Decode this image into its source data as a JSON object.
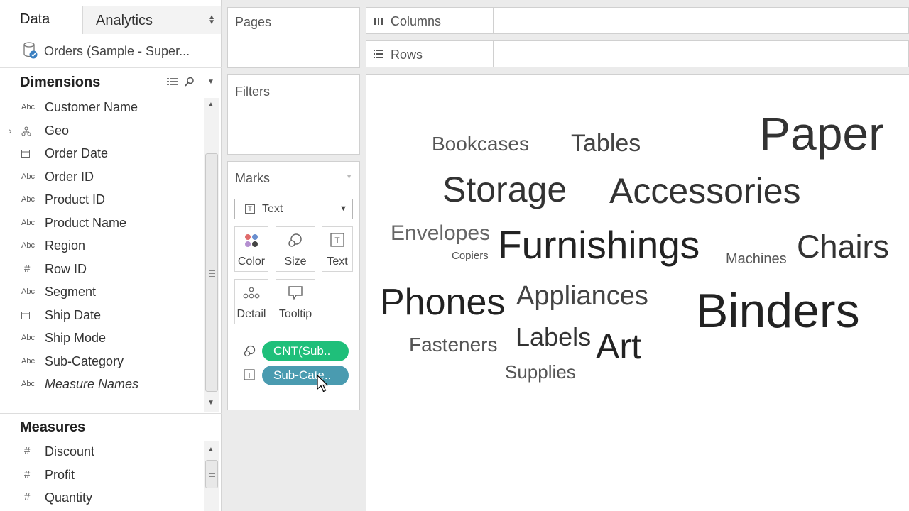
{
  "tabs": {
    "data": "Data",
    "analytics": "Analytics"
  },
  "datasource": {
    "label": "Orders (Sample - Super...",
    "icon": "database-icon"
  },
  "dimensions": {
    "title": "Dimensions",
    "fields": [
      {
        "type": "Abc",
        "name": "Customer Name"
      },
      {
        "type": "geo-icon",
        "name": "Geo"
      },
      {
        "type": "calendar-icon",
        "name": "Order Date"
      },
      {
        "type": "Abc",
        "name": "Order ID"
      },
      {
        "type": "Abc",
        "name": "Product ID"
      },
      {
        "type": "Abc",
        "name": "Product Name"
      },
      {
        "type": "Abc",
        "name": "Region"
      },
      {
        "type": "#",
        "name": "Row ID"
      },
      {
        "type": "Abc",
        "name": "Segment"
      },
      {
        "type": "calendar-icon",
        "name": "Ship Date"
      },
      {
        "type": "Abc",
        "name": "Ship Mode"
      },
      {
        "type": "Abc",
        "name": "Sub-Category"
      },
      {
        "type": "Abc",
        "name": "Measure Names"
      }
    ]
  },
  "measures": {
    "title": "Measures",
    "fields": [
      {
        "type": "#",
        "name": "Discount"
      },
      {
        "type": "#",
        "name": "Profit"
      },
      {
        "type": "#",
        "name": "Quantity"
      }
    ]
  },
  "shelves": {
    "pages": "Pages",
    "filters": "Filters",
    "marks": "Marks",
    "columns": "Columns",
    "rows": "Rows"
  },
  "marks": {
    "type": "Text",
    "buttons": {
      "color": "Color",
      "size": "Size",
      "text": "Text",
      "detail": "Detail",
      "tooltip": "Tooltip"
    },
    "pills": [
      {
        "label": "CNT(Sub..",
        "color": "#1fbf7a",
        "icon": "size-icon"
      },
      {
        "label": "Sub-Cate..",
        "color": "#4a9bb0",
        "icon": "text-icon"
      }
    ]
  },
  "word_cloud": [
    {
      "text": "Paper",
      "size": 66
    },
    {
      "text": "Bookcases",
      "size": 28
    },
    {
      "text": "Tables",
      "size": 34
    },
    {
      "text": "Storage",
      "size": 50
    },
    {
      "text": "Accessories",
      "size": 50
    },
    {
      "text": "Envelopes",
      "size": 30
    },
    {
      "text": "Copiers",
      "size": 15
    },
    {
      "text": "Furnishings",
      "size": 55
    },
    {
      "text": "Machines",
      "size": 20
    },
    {
      "text": "Chairs",
      "size": 45
    },
    {
      "text": "Phones",
      "size": 52
    },
    {
      "text": "Appliances",
      "size": 38
    },
    {
      "text": "Binders",
      "size": 68
    },
    {
      "text": "Fasteners",
      "size": 28
    },
    {
      "text": "Labels",
      "size": 36
    },
    {
      "text": "Art",
      "size": 50
    },
    {
      "text": "Supplies",
      "size": 26
    }
  ]
}
